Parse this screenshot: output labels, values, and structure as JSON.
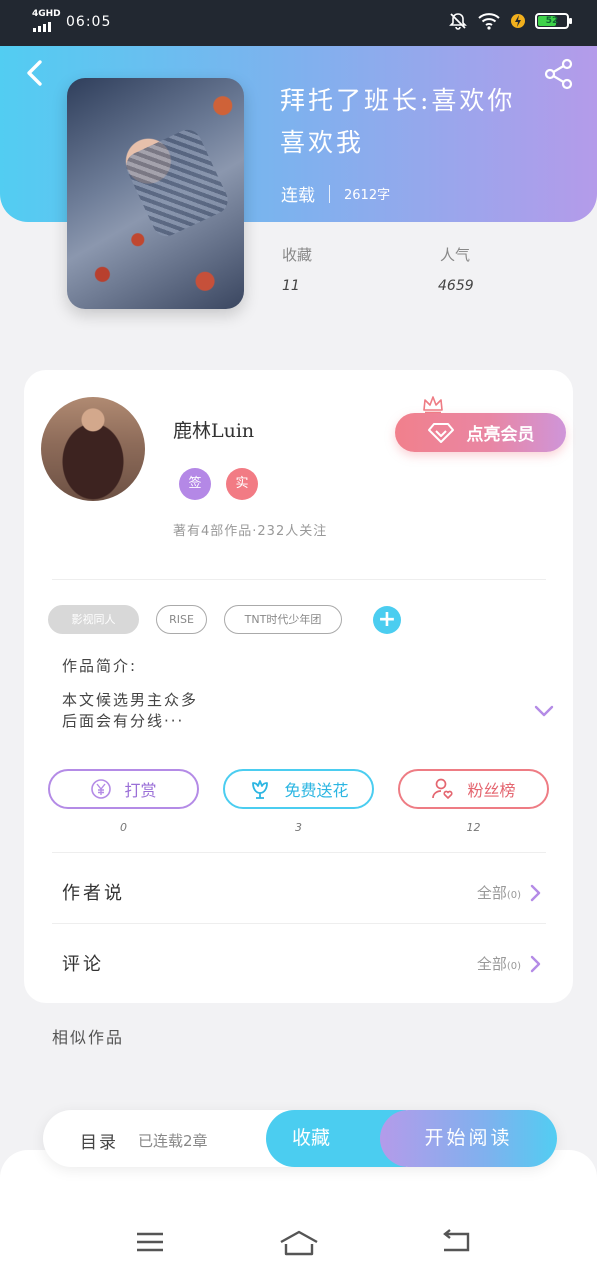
{
  "status_bar": {
    "network": "4GHD",
    "time": "06:05",
    "battery_level": "52"
  },
  "book": {
    "title_line1": "拜托了班长:喜欢你",
    "title_line2": "喜欢我",
    "status": "连载",
    "word_count": "2612字",
    "favorites_label": "收藏",
    "favorites_value": "11",
    "popularity_label": "人气",
    "popularity_value": "4659"
  },
  "author": {
    "name": "鹿林Luin",
    "badge_signed": "签",
    "badge_verified": "实",
    "meta": "著有4部作品·232人关注",
    "vip_button": "点亮会员"
  },
  "tags": [
    "影视同人",
    "RISE",
    "TNT时代少年团"
  ],
  "intro": {
    "label": "作品简介:",
    "line1": "本文候选男主众多",
    "line2": "后面会有分线···"
  },
  "actions": {
    "tip_label": "打赏",
    "tip_count": "0",
    "flower_label": "免费送花",
    "flower_count": "3",
    "fans_label": "粉丝榜",
    "fans_count": "12"
  },
  "sections": {
    "author_says": "作者说",
    "author_says_all": "全部",
    "author_says_count": "(0)",
    "comments": "评论",
    "comments_all": "全部",
    "comments_count": "(0)",
    "similar": "相似作品"
  },
  "bottom_bar": {
    "toc": "目录",
    "chapters": "已连载2章",
    "favorite": "收藏",
    "read": "开始阅读"
  },
  "colors": {
    "cyan": "#4bcdf0",
    "purple": "#b49bea",
    "pink": "#ee7c84"
  }
}
